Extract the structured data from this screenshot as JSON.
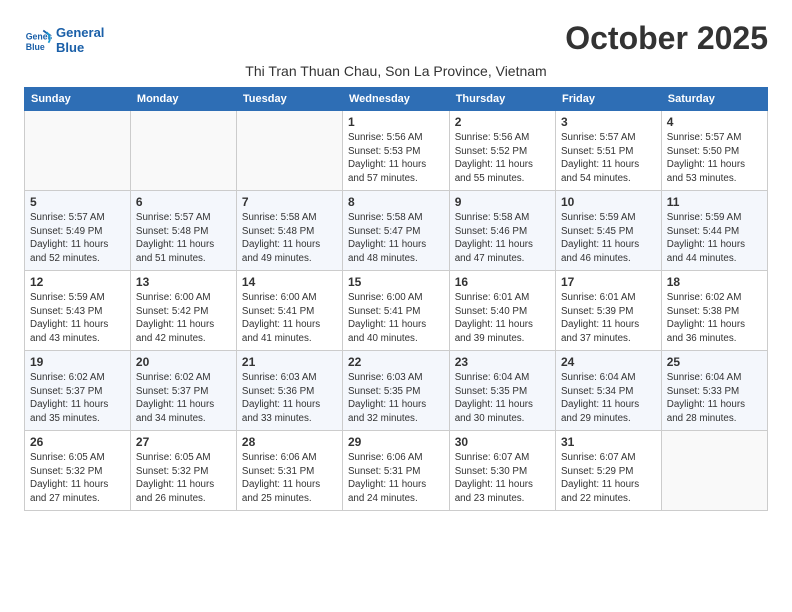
{
  "header": {
    "logo_line1": "General",
    "logo_line2": "Blue",
    "month_title": "October 2025",
    "subtitle": "Thi Tran Thuan Chau, Son La Province, Vietnam"
  },
  "weekdays": [
    "Sunday",
    "Monday",
    "Tuesday",
    "Wednesday",
    "Thursday",
    "Friday",
    "Saturday"
  ],
  "weeks": [
    [
      {
        "day": "",
        "info": ""
      },
      {
        "day": "",
        "info": ""
      },
      {
        "day": "",
        "info": ""
      },
      {
        "day": "1",
        "info": "Sunrise: 5:56 AM\nSunset: 5:53 PM\nDaylight: 11 hours\nand 57 minutes."
      },
      {
        "day": "2",
        "info": "Sunrise: 5:56 AM\nSunset: 5:52 PM\nDaylight: 11 hours\nand 55 minutes."
      },
      {
        "day": "3",
        "info": "Sunrise: 5:57 AM\nSunset: 5:51 PM\nDaylight: 11 hours\nand 54 minutes."
      },
      {
        "day": "4",
        "info": "Sunrise: 5:57 AM\nSunset: 5:50 PM\nDaylight: 11 hours\nand 53 minutes."
      }
    ],
    [
      {
        "day": "5",
        "info": "Sunrise: 5:57 AM\nSunset: 5:49 PM\nDaylight: 11 hours\nand 52 minutes."
      },
      {
        "day": "6",
        "info": "Sunrise: 5:57 AM\nSunset: 5:48 PM\nDaylight: 11 hours\nand 51 minutes."
      },
      {
        "day": "7",
        "info": "Sunrise: 5:58 AM\nSunset: 5:48 PM\nDaylight: 11 hours\nand 49 minutes."
      },
      {
        "day": "8",
        "info": "Sunrise: 5:58 AM\nSunset: 5:47 PM\nDaylight: 11 hours\nand 48 minutes."
      },
      {
        "day": "9",
        "info": "Sunrise: 5:58 AM\nSunset: 5:46 PM\nDaylight: 11 hours\nand 47 minutes."
      },
      {
        "day": "10",
        "info": "Sunrise: 5:59 AM\nSunset: 5:45 PM\nDaylight: 11 hours\nand 46 minutes."
      },
      {
        "day": "11",
        "info": "Sunrise: 5:59 AM\nSunset: 5:44 PM\nDaylight: 11 hours\nand 44 minutes."
      }
    ],
    [
      {
        "day": "12",
        "info": "Sunrise: 5:59 AM\nSunset: 5:43 PM\nDaylight: 11 hours\nand 43 minutes."
      },
      {
        "day": "13",
        "info": "Sunrise: 6:00 AM\nSunset: 5:42 PM\nDaylight: 11 hours\nand 42 minutes."
      },
      {
        "day": "14",
        "info": "Sunrise: 6:00 AM\nSunset: 5:41 PM\nDaylight: 11 hours\nand 41 minutes."
      },
      {
        "day": "15",
        "info": "Sunrise: 6:00 AM\nSunset: 5:41 PM\nDaylight: 11 hours\nand 40 minutes."
      },
      {
        "day": "16",
        "info": "Sunrise: 6:01 AM\nSunset: 5:40 PM\nDaylight: 11 hours\nand 39 minutes."
      },
      {
        "day": "17",
        "info": "Sunrise: 6:01 AM\nSunset: 5:39 PM\nDaylight: 11 hours\nand 37 minutes."
      },
      {
        "day": "18",
        "info": "Sunrise: 6:02 AM\nSunset: 5:38 PM\nDaylight: 11 hours\nand 36 minutes."
      }
    ],
    [
      {
        "day": "19",
        "info": "Sunrise: 6:02 AM\nSunset: 5:37 PM\nDaylight: 11 hours\nand 35 minutes."
      },
      {
        "day": "20",
        "info": "Sunrise: 6:02 AM\nSunset: 5:37 PM\nDaylight: 11 hours\nand 34 minutes."
      },
      {
        "day": "21",
        "info": "Sunrise: 6:03 AM\nSunset: 5:36 PM\nDaylight: 11 hours\nand 33 minutes."
      },
      {
        "day": "22",
        "info": "Sunrise: 6:03 AM\nSunset: 5:35 PM\nDaylight: 11 hours\nand 32 minutes."
      },
      {
        "day": "23",
        "info": "Sunrise: 6:04 AM\nSunset: 5:35 PM\nDaylight: 11 hours\nand 30 minutes."
      },
      {
        "day": "24",
        "info": "Sunrise: 6:04 AM\nSunset: 5:34 PM\nDaylight: 11 hours\nand 29 minutes."
      },
      {
        "day": "25",
        "info": "Sunrise: 6:04 AM\nSunset: 5:33 PM\nDaylight: 11 hours\nand 28 minutes."
      }
    ],
    [
      {
        "day": "26",
        "info": "Sunrise: 6:05 AM\nSunset: 5:32 PM\nDaylight: 11 hours\nand 27 minutes."
      },
      {
        "day": "27",
        "info": "Sunrise: 6:05 AM\nSunset: 5:32 PM\nDaylight: 11 hours\nand 26 minutes."
      },
      {
        "day": "28",
        "info": "Sunrise: 6:06 AM\nSunset: 5:31 PM\nDaylight: 11 hours\nand 25 minutes."
      },
      {
        "day": "29",
        "info": "Sunrise: 6:06 AM\nSunset: 5:31 PM\nDaylight: 11 hours\nand 24 minutes."
      },
      {
        "day": "30",
        "info": "Sunrise: 6:07 AM\nSunset: 5:30 PM\nDaylight: 11 hours\nand 23 minutes."
      },
      {
        "day": "31",
        "info": "Sunrise: 6:07 AM\nSunset: 5:29 PM\nDaylight: 11 hours\nand 22 minutes."
      },
      {
        "day": "",
        "info": ""
      }
    ]
  ]
}
